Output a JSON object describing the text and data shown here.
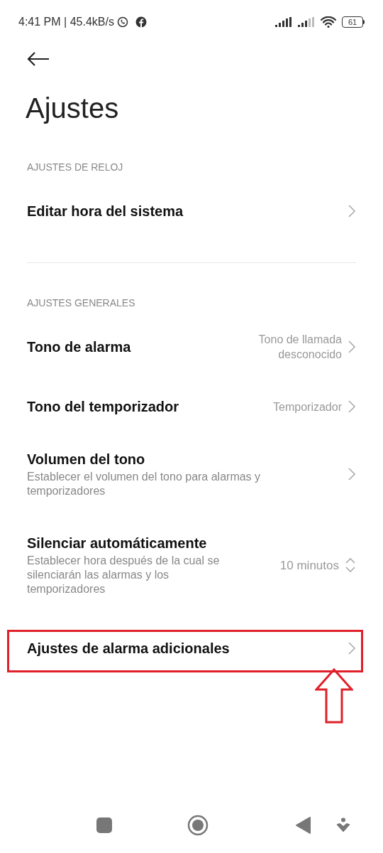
{
  "status_bar": {
    "time": "4:41 PM | 45.4kB/s",
    "battery": "61"
  },
  "title": "Ajustes",
  "sections": [
    {
      "header": "AJUSTES DE RELOJ",
      "items": [
        {
          "kind": "chevron",
          "title": "Editar hora del sistema",
          "highlighted": false
        }
      ]
    },
    {
      "header": "AJUSTES GENERALES",
      "items": [
        {
          "kind": "chevron",
          "title": "Tono de alarma",
          "value": "Tono de llamada desconocido",
          "highlighted": false
        },
        {
          "kind": "chevron",
          "title": "Tono del temporizador",
          "value": "Temporizador",
          "highlighted": false
        },
        {
          "kind": "chevron",
          "title": "Volumen del tono",
          "subtitle": "Establecer el volumen del tono para alarmas y temporizadores",
          "highlighted": false
        },
        {
          "kind": "updown",
          "title": "Silenciar automáticamente",
          "subtitle": "Establecer hora después de la cual se silenciarán las alarmas y los temporizadores",
          "value": "10 minutos",
          "highlighted": false
        },
        {
          "kind": "chevron",
          "title": "Ajustes de alarma adicionales",
          "highlighted": true
        }
      ]
    }
  ]
}
